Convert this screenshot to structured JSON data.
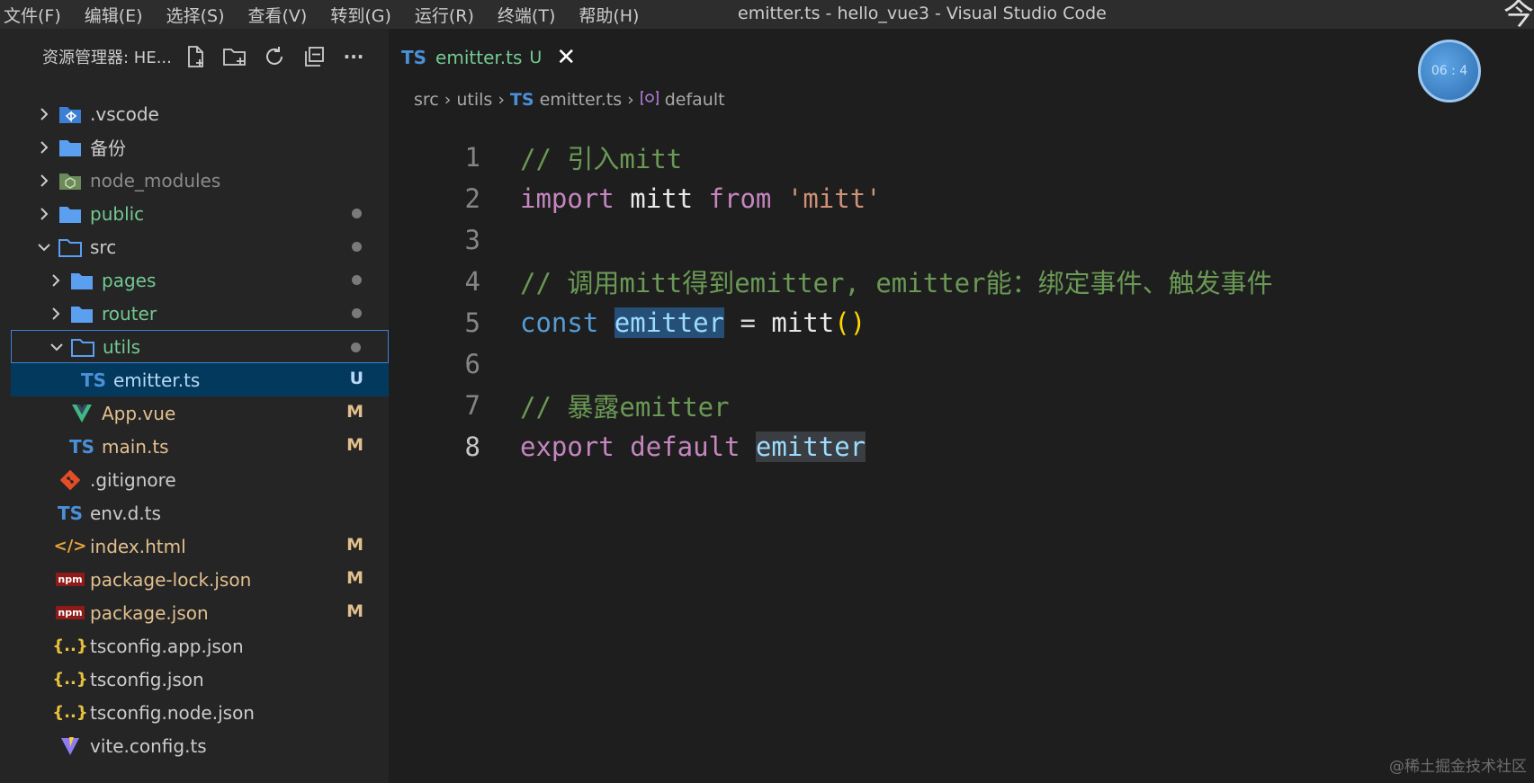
{
  "menu": {
    "items": [
      "文件(F)",
      "编辑(E)",
      "选择(S)",
      "查看(V)",
      "转到(G)",
      "运行(R)",
      "终端(T)",
      "帮助(H)"
    ],
    "window_title": "emitter.ts - hello_vue3 - Visual Studio Code",
    "corner_glyph": "今"
  },
  "sidebar": {
    "title": "资源管理器: HE...",
    "actions": [
      "new-file",
      "new-folder",
      "refresh",
      "collapse-all",
      "more"
    ],
    "more_label": "···"
  },
  "tree": [
    {
      "name": ".vscode",
      "icon": "vscode-folder-icon",
      "chevron": "right",
      "indent": 0,
      "color": "white"
    },
    {
      "name": "备份",
      "icon": "folder-icon",
      "chevron": "right",
      "indent": 0,
      "color": "white"
    },
    {
      "name": "node_modules",
      "icon": "node-folder-icon",
      "chevron": "right",
      "indent": 0,
      "color": "gray"
    },
    {
      "name": "public",
      "icon": "folder-icon",
      "chevron": "right",
      "indent": 0,
      "color": "green",
      "dot": true
    },
    {
      "name": "src",
      "icon": "folder-open-icon",
      "chevron": "down",
      "indent": 0,
      "color": "white",
      "dot": true
    },
    {
      "name": "pages",
      "icon": "folder-icon",
      "chevron": "right",
      "indent": 1,
      "color": "green",
      "dot": true
    },
    {
      "name": "router",
      "icon": "folder-icon",
      "chevron": "right",
      "indent": 1,
      "color": "green",
      "dot": true
    },
    {
      "name": "utils",
      "icon": "folder-open-icon",
      "chevron": "down",
      "indent": 1,
      "color": "green",
      "dot": true,
      "focus": true
    },
    {
      "name": "emitter.ts",
      "icon": "ts-icon",
      "chevron": "none",
      "indent": 2,
      "color": "ubright",
      "status": "U",
      "selected": true
    },
    {
      "name": "App.vue",
      "icon": "vue-icon",
      "chevron": "none",
      "indent": 1,
      "color": "yellow",
      "status": "M"
    },
    {
      "name": "main.ts",
      "icon": "ts-icon",
      "chevron": "none",
      "indent": 1,
      "color": "yellow",
      "status": "M"
    },
    {
      "name": ".gitignore",
      "icon": "git-icon",
      "chevron": "none",
      "indent": 0,
      "color": "white"
    },
    {
      "name": "env.d.ts",
      "icon": "ts-icon",
      "chevron": "none",
      "indent": 0,
      "color": "white"
    },
    {
      "name": "index.html",
      "icon": "html-icon",
      "chevron": "none",
      "indent": 0,
      "color": "yellow",
      "status": "M"
    },
    {
      "name": "package-lock.json",
      "icon": "npm-icon",
      "chevron": "none",
      "indent": 0,
      "color": "yellow",
      "status": "M"
    },
    {
      "name": "package.json",
      "icon": "npm-icon",
      "chevron": "none",
      "indent": 0,
      "color": "yellow",
      "status": "M"
    },
    {
      "name": "tsconfig.app.json",
      "icon": "json-icon",
      "chevron": "none",
      "indent": 0,
      "color": "white"
    },
    {
      "name": "tsconfig.json",
      "icon": "json-icon",
      "chevron": "none",
      "indent": 0,
      "color": "white"
    },
    {
      "name": "tsconfig.node.json",
      "icon": "json-icon",
      "chevron": "none",
      "indent": 0,
      "color": "white"
    },
    {
      "name": "vite.config.ts",
      "icon": "vite-icon",
      "chevron": "none",
      "indent": 0,
      "color": "white"
    }
  ],
  "tab": {
    "badge": "TS",
    "name": "emitter.ts",
    "status": "U",
    "close": "✕"
  },
  "breadcrumb": {
    "parts": [
      "src",
      "utils",
      "emitter.ts",
      "default"
    ],
    "ts_badge": "TS"
  },
  "avatar_text": "06 : 4",
  "code": [
    {
      "n": "1",
      "tokens": [
        [
          "comment",
          "// 引入mitt"
        ]
      ]
    },
    {
      "n": "2",
      "tokens": [
        [
          "kw",
          "import"
        ],
        [
          "plain",
          " "
        ],
        [
          "var",
          "mitt"
        ],
        [
          "plain",
          " "
        ],
        [
          "kw",
          "from"
        ],
        [
          "plain",
          " "
        ],
        [
          "str",
          "'mitt'"
        ]
      ]
    },
    {
      "n": "3",
      "tokens": []
    },
    {
      "n": "4",
      "tokens": [
        [
          "comment",
          "// 调用mitt得到emitter, emitter能：绑定事件、触发事件"
        ]
      ]
    },
    {
      "n": "5",
      "tokens": [
        [
          "decl",
          "const"
        ],
        [
          "plain",
          " "
        ],
        [
          "var-hl1",
          "emitter"
        ],
        [
          "plain",
          " = "
        ],
        [
          "fn",
          "mitt"
        ],
        [
          "paren",
          "()"
        ]
      ]
    },
    {
      "n": "6",
      "tokens": []
    },
    {
      "n": "7",
      "tokens": [
        [
          "comment",
          "// 暴露emitter"
        ]
      ]
    },
    {
      "n": "8",
      "tokens": [
        [
          "kw",
          "export"
        ],
        [
          "plain",
          " "
        ],
        [
          "kw",
          "default"
        ],
        [
          "plain",
          " "
        ],
        [
          "var-hl2",
          "emitter"
        ]
      ],
      "active": true
    }
  ],
  "watermark": "@稀土掘金技术社区"
}
